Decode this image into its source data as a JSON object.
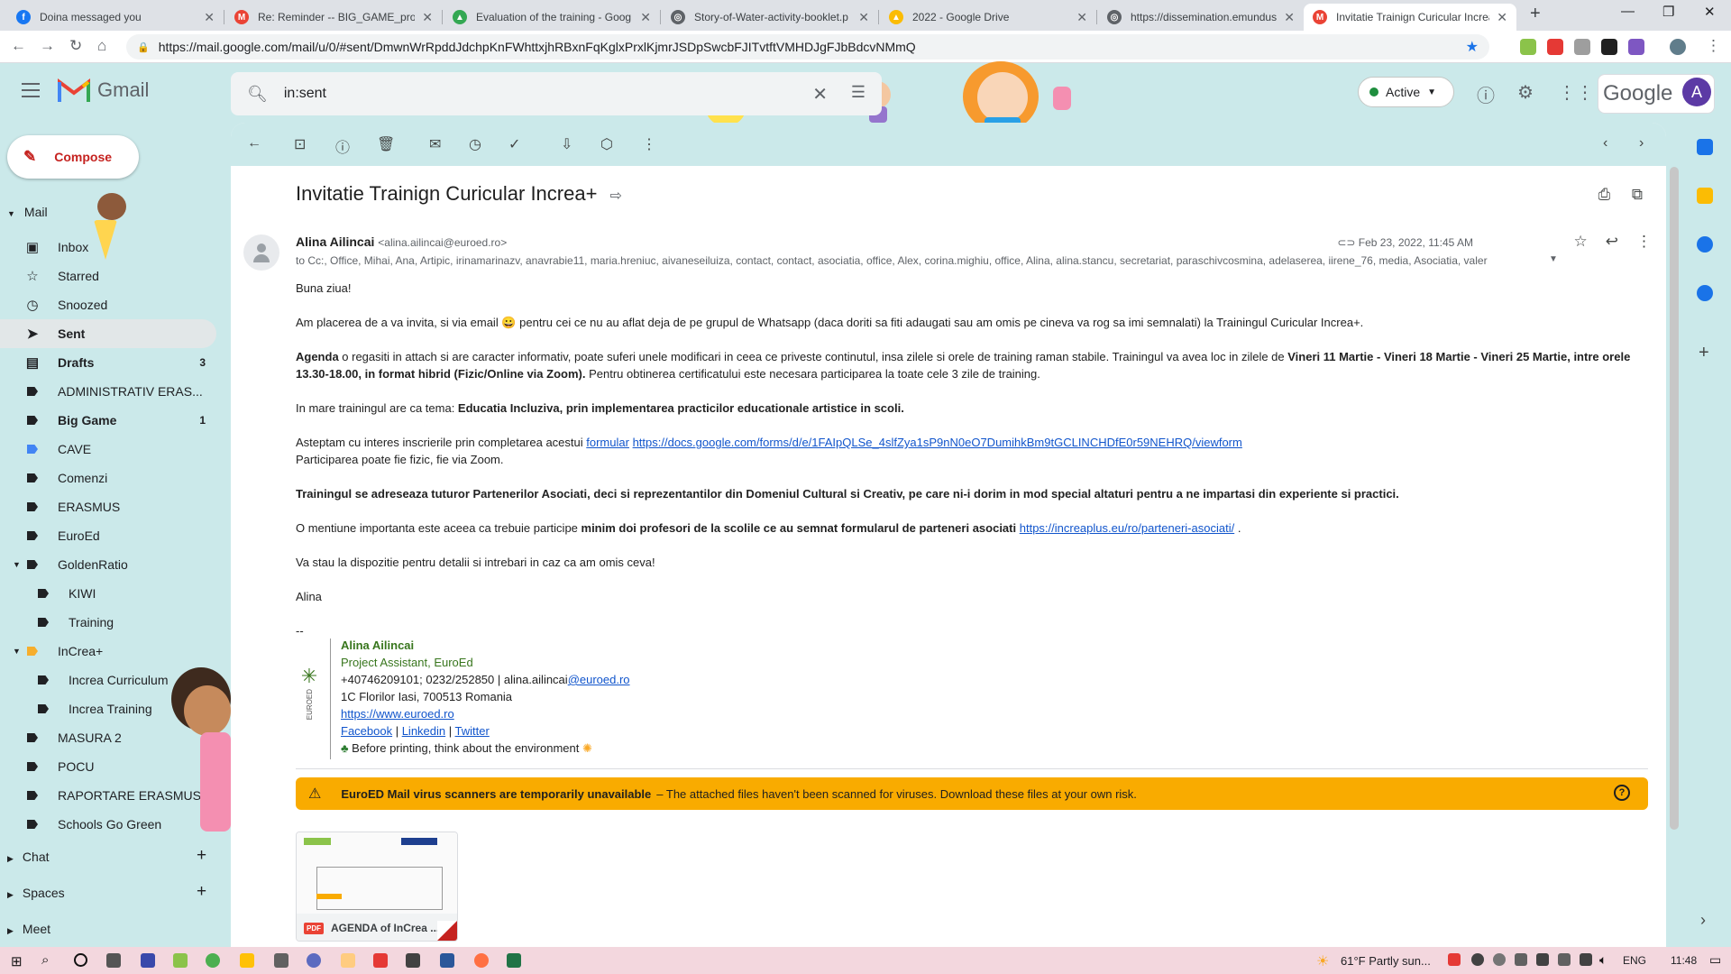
{
  "browser": {
    "tabs": [
      {
        "title": "Doina messaged you",
        "icon": "facebook-icon",
        "color": "#1877f2"
      },
      {
        "title": "Re: Reminder -- BIG_GAME_proje",
        "icon": "gmail-icon",
        "color": "#ea4335"
      },
      {
        "title": "Evaluation of the training - Goog",
        "icon": "google-drive-icon",
        "color": "#34a853"
      },
      {
        "title": "Story-of-Water-activity-booklet.p",
        "icon": "globe-icon",
        "color": "#5f6368"
      },
      {
        "title": "2022 - Google Drive",
        "icon": "google-drive-icon",
        "color": "#fbbc04"
      },
      {
        "title": "https://dissemination.emundus.fr",
        "icon": "globe-icon",
        "color": "#5f6368"
      },
      {
        "title": "Invitatie Trainign Curicular Increa",
        "icon": "gmail-icon",
        "color": "#ea4335"
      }
    ],
    "url": "https://mail.google.com/mail/u/0/#sent/DmwnWrRpddJdchpKnFWhttxjhRBxnFqKglxPrxlKjmrJSDpSwcbFJITvtftVMHDJgFJbBdcvNMmQ"
  },
  "gmail": {
    "app_name": "Gmail",
    "search_value": "in:sent",
    "status": "Active",
    "google_word": "Google",
    "avatar_letter": "A",
    "compose_label": "Compose",
    "sections": {
      "mail": "Mail",
      "chat": "Chat",
      "spaces": "Spaces",
      "meet": "Meet"
    },
    "nav": [
      {
        "label": "Inbox",
        "icon": "inbox-icon",
        "count": "",
        "bold": false,
        "kind": "system"
      },
      {
        "label": "Starred",
        "icon": "star-icon",
        "count": "",
        "bold": false,
        "kind": "system"
      },
      {
        "label": "Snoozed",
        "icon": "clock-icon",
        "count": "",
        "bold": false,
        "kind": "system"
      },
      {
        "label": "Sent",
        "icon": "send-icon",
        "count": "",
        "bold": true,
        "kind": "system"
      },
      {
        "label": "Drafts",
        "icon": "draft-icon",
        "count": "3",
        "bold": true,
        "kind": "system"
      },
      {
        "label": "ADMINISTRATIV ERAS...",
        "count": "",
        "bold": false,
        "kind": "label",
        "color": "#202124"
      },
      {
        "label": "Big Game",
        "count": "1",
        "bold": true,
        "kind": "label",
        "color": "#202124"
      },
      {
        "label": "CAVE",
        "count": "",
        "bold": false,
        "kind": "label",
        "color": "#4285f4"
      },
      {
        "label": "Comenzi",
        "count": "",
        "bold": false,
        "kind": "label",
        "color": "#202124"
      },
      {
        "label": "ERASMUS",
        "count": "",
        "bold": false,
        "kind": "label",
        "color": "#202124"
      },
      {
        "label": "EuroEd",
        "count": "",
        "bold": false,
        "kind": "label",
        "color": "#202124"
      },
      {
        "label": "GoldenRatio",
        "count": "",
        "bold": false,
        "kind": "parent",
        "color": "#202124"
      },
      {
        "label": "KIWI",
        "count": "",
        "bold": false,
        "kind": "sub",
        "color": "#202124"
      },
      {
        "label": "Training",
        "count": "",
        "bold": false,
        "kind": "sub",
        "color": "#202124"
      },
      {
        "label": "InCrea+",
        "count": "",
        "bold": false,
        "kind": "parent",
        "color": "#f6ae2d"
      },
      {
        "label": "Increa Curriculum",
        "count": "",
        "bold": false,
        "kind": "sub",
        "color": "#202124"
      },
      {
        "label": "Increa Training",
        "count": "",
        "bold": false,
        "kind": "sub",
        "color": "#202124"
      },
      {
        "label": "MASURA 2",
        "count": "",
        "bold": false,
        "kind": "label",
        "color": "#202124"
      },
      {
        "label": "POCU",
        "count": "",
        "bold": false,
        "kind": "label",
        "color": "#202124"
      },
      {
        "label": "RAPORTARE ERASMUS",
        "count": "",
        "bold": false,
        "kind": "label",
        "color": "#202124"
      },
      {
        "label": "Schools Go Green",
        "count": "",
        "bold": false,
        "kind": "label",
        "color": "#202124"
      }
    ]
  },
  "email": {
    "subject": "Invitatie Trainign Curicular Increa+",
    "sender_name": "Alina Ailincai",
    "sender_email": "<alina.ailincai@euroed.ro>",
    "date": "Feb 23, 2022, 11:45 AM",
    "to": "to Cc:, Office, Mihai, Ana, Artipic, irinamarinazv, anavrabie11, maria.hreniuc, aivaneseiluiza, contact, contact, asociatia, office, Alex, corina.mighiu, office, Alina, alina.stancu, secretariat, paraschivcosmina, adelaserea, iirene_76, media, Asociatia, valer",
    "greeting": "Buna ziua!",
    "p1a": "Am placerea de a va invita, si via email 😀 pentru cei ce nu au aflat deja de pe grupul de Whatsapp (daca doriti sa fiti adaugati sau am omis pe cineva va rog sa imi semnalati) la Trainingul Curicular Increa+.",
    "p2_agenda": "Agenda",
    "p2a": " o regasiti in attach si are caracter informativ, poate suferi unele modificari in ceea ce priveste continutul, insa zilele si orele de training raman stabile.  Trainingul va avea loc in zilele de ",
    "p2_dates": "Vineri 11 Martie - Vineri 18 Martie - Vineri 25 Martie, intre orele 13.30-18.00, in format hibrid (Fizic/Online via Zoom).",
    "p2b": " Pentru obtinerea certificatului este necesara participarea la toate cele 3 zile de training.",
    "p3a": "In mare trainingul are ca tema: ",
    "p3_theme": "Educatia Incluziva, prin implementarea practicilor educationale artistice in scoli.",
    "p4a": "Asteptam cu interes inscrierile prin completarea acestui ",
    "p4_link1": "formular",
    "p4_link2": "https://docs.google.com/forms/d/e/1FAIpQLSe_4slfZya1sP9nN0eO7DumihkBm9tGCLINCHDfE0r59NEHRQ/viewform",
    "p4b": "Participarea poate fie fizic, fie via Zoom.",
    "p5": "Trainingul se adreseaza tuturor Partenerilor Asociati, deci si reprezentantilor din Domeniul Cultural si Creativ, pe care ni-i dorim in mod special altaturi pentru a ne impartasi din experiente si practici.",
    "p6a": "O mentiune importanta este aceea ca trebuie participe ",
    "p6_bold": "minim doi profesori de la scolile ce au semnat formularul de parteneri asociati",
    "p6_link": "https://increaplus.eu/ro/parteneri-asociati/",
    "p6b": " .",
    "p7": "Va stau la dispozitie pentru detalii si intrebari in caz ca am omis ceva!",
    "closing": "Alina",
    "dashes": "--",
    "signature": {
      "name": "Alina Ailincai",
      "role": "Project Assistant, EuroEd",
      "phone": "+40746209101; 0232/252850 | alina.ailincai",
      "phone_link": "@euroed.ro",
      "address": "1C Florilor Iasi, 700513 Romania",
      "site": "https://www.euroed.ro",
      "social": [
        "Facebook",
        "Linkedin",
        "Twitter"
      ],
      "eco": "Before printing, think about the environment",
      "logo_text": "EUROED"
    },
    "warning_bold": "EuroED Mail virus scanners are temporarily unavailable",
    "warning_text": "– The attached files haven't been scanned for viruses. Download these files at your own risk.",
    "attachment": {
      "name": "AGENDA of InCrea ...",
      "type": "PDF"
    }
  },
  "taskbar": {
    "weather": "61°F  Partly sun...",
    "lang": "ENG",
    "time": "11:48"
  }
}
